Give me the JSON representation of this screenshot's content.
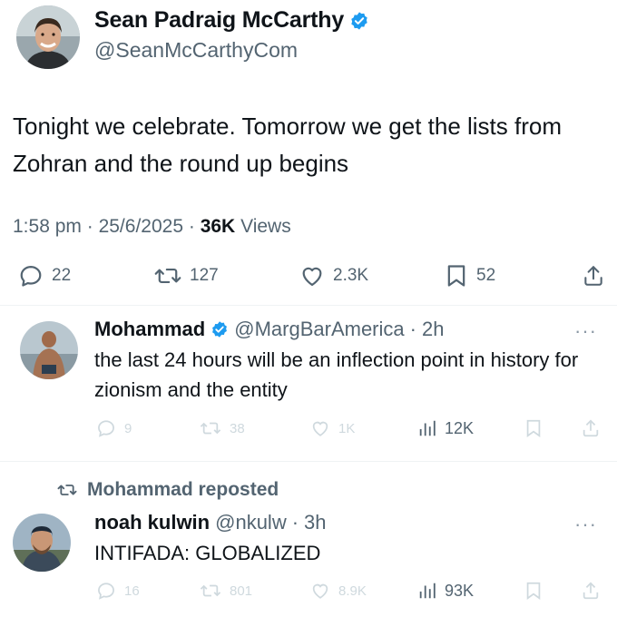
{
  "main_tweet": {
    "name": "Sean Padraig McCarthy",
    "handle": "@SeanMcCarthyCom",
    "text": "Tonight we celebrate. Tomorrow we get the lists from Zohran and the round up begins",
    "time": "1:58 pm",
    "date": "25/6/2025",
    "views_count": "36K",
    "views_label": "Views",
    "replies": "22",
    "reposts": "127",
    "likes": "2.3K",
    "bookmarks": "52"
  },
  "reply": {
    "name": "Mohammad",
    "handle": "@MargBarAmerica",
    "time": "2h",
    "text": "the last 24 hours will be an inflection point in history for zionism and the entity",
    "replies": "9",
    "reposts": "38",
    "likes": "1K",
    "views": "12K"
  },
  "repost": {
    "repost_label": "Mohammad reposted",
    "name": "noah kulwin",
    "handle": "@nkulw",
    "time": "3h",
    "text": "INTIFADA: GLOBALIZED",
    "replies": "16",
    "reposts": "801",
    "likes": "8.9K",
    "views": "93K"
  },
  "separator": "·",
  "more_label": "···",
  "colors": {
    "verified": "#1d9bf0",
    "text_primary": "#0f1419",
    "text_secondary": "#536471",
    "faded": "#cfd9de"
  },
  "icons": [
    "reply-icon",
    "repost-icon",
    "like-icon",
    "bookmark-icon",
    "share-icon",
    "views-icon",
    "verified-badge-icon",
    "more-icon"
  ]
}
